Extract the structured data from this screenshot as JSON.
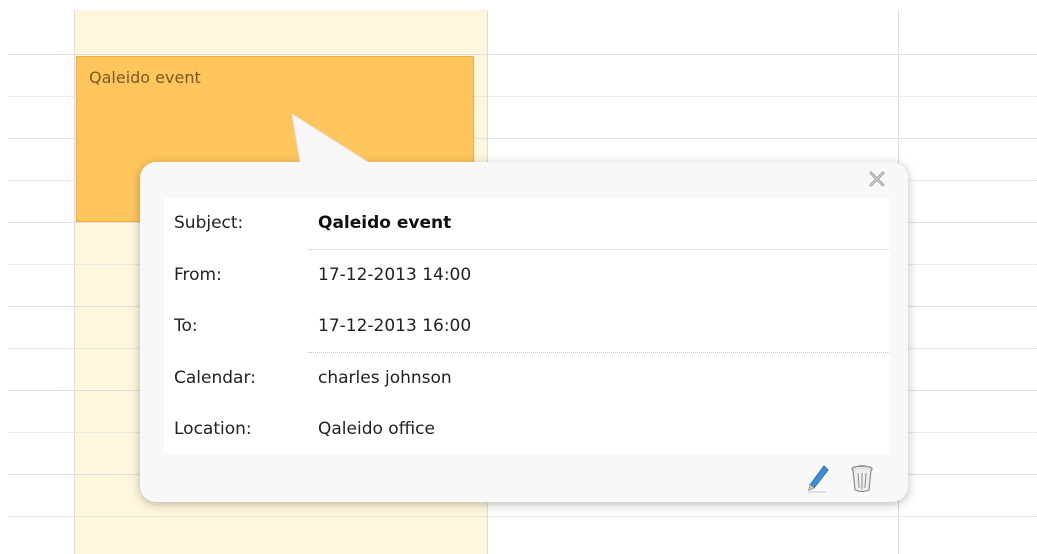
{
  "event_block": {
    "title": "Qaleido event",
    "color": "#ffc65e"
  },
  "popup": {
    "close_icon": "close-icon",
    "fields": [
      {
        "label": "Subject:",
        "value": "Qaleido event"
      },
      {
        "label": "From:",
        "value": "17-12-2013 14:00"
      },
      {
        "label": "To:",
        "value": "17-12-2013 16:00"
      },
      {
        "label": "Calendar:",
        "value": "charles johnson"
      },
      {
        "label": "Location:",
        "value": "Qaleido office"
      }
    ],
    "actions": {
      "edit_icon": "pencil-icon",
      "delete_icon": "trash-icon"
    }
  },
  "colors": {
    "today_column": "#fff7dd",
    "event": "#ffc65e",
    "popup_background": "#f8f8f8"
  }
}
